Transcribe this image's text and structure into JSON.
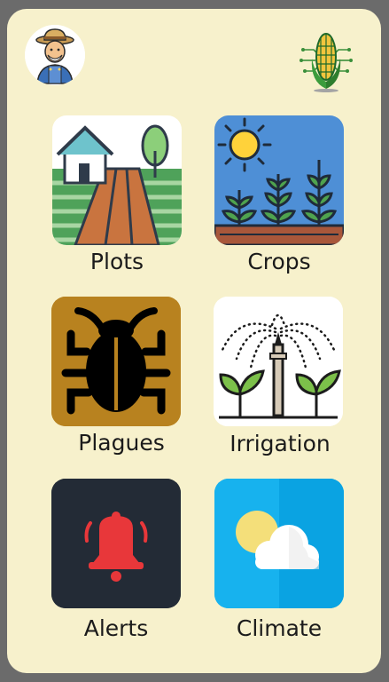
{
  "header": {
    "avatar_icon": "farmer-icon",
    "logo_icon": "corn-circuit-logo-icon"
  },
  "menu": [
    {
      "label": "Plots",
      "icon": "farm-plot-icon"
    },
    {
      "label": "Crops",
      "icon": "crops-sun-icon"
    },
    {
      "label": "Plagues",
      "icon": "bug-icon"
    },
    {
      "label": "Irrigation",
      "icon": "sprinkler-icon"
    },
    {
      "label": "Alerts",
      "icon": "bell-icon"
    },
    {
      "label": "Climate",
      "icon": "sun-cloud-icon"
    }
  ],
  "colors": {
    "page_bg": "#6b6b6b",
    "panel_bg": "#f7f1cc",
    "plague_tile": "#b8821f",
    "alerts_tile": "#232b36",
    "alert_bell": "#e8373a",
    "climate_tile": "#17b2ee"
  }
}
